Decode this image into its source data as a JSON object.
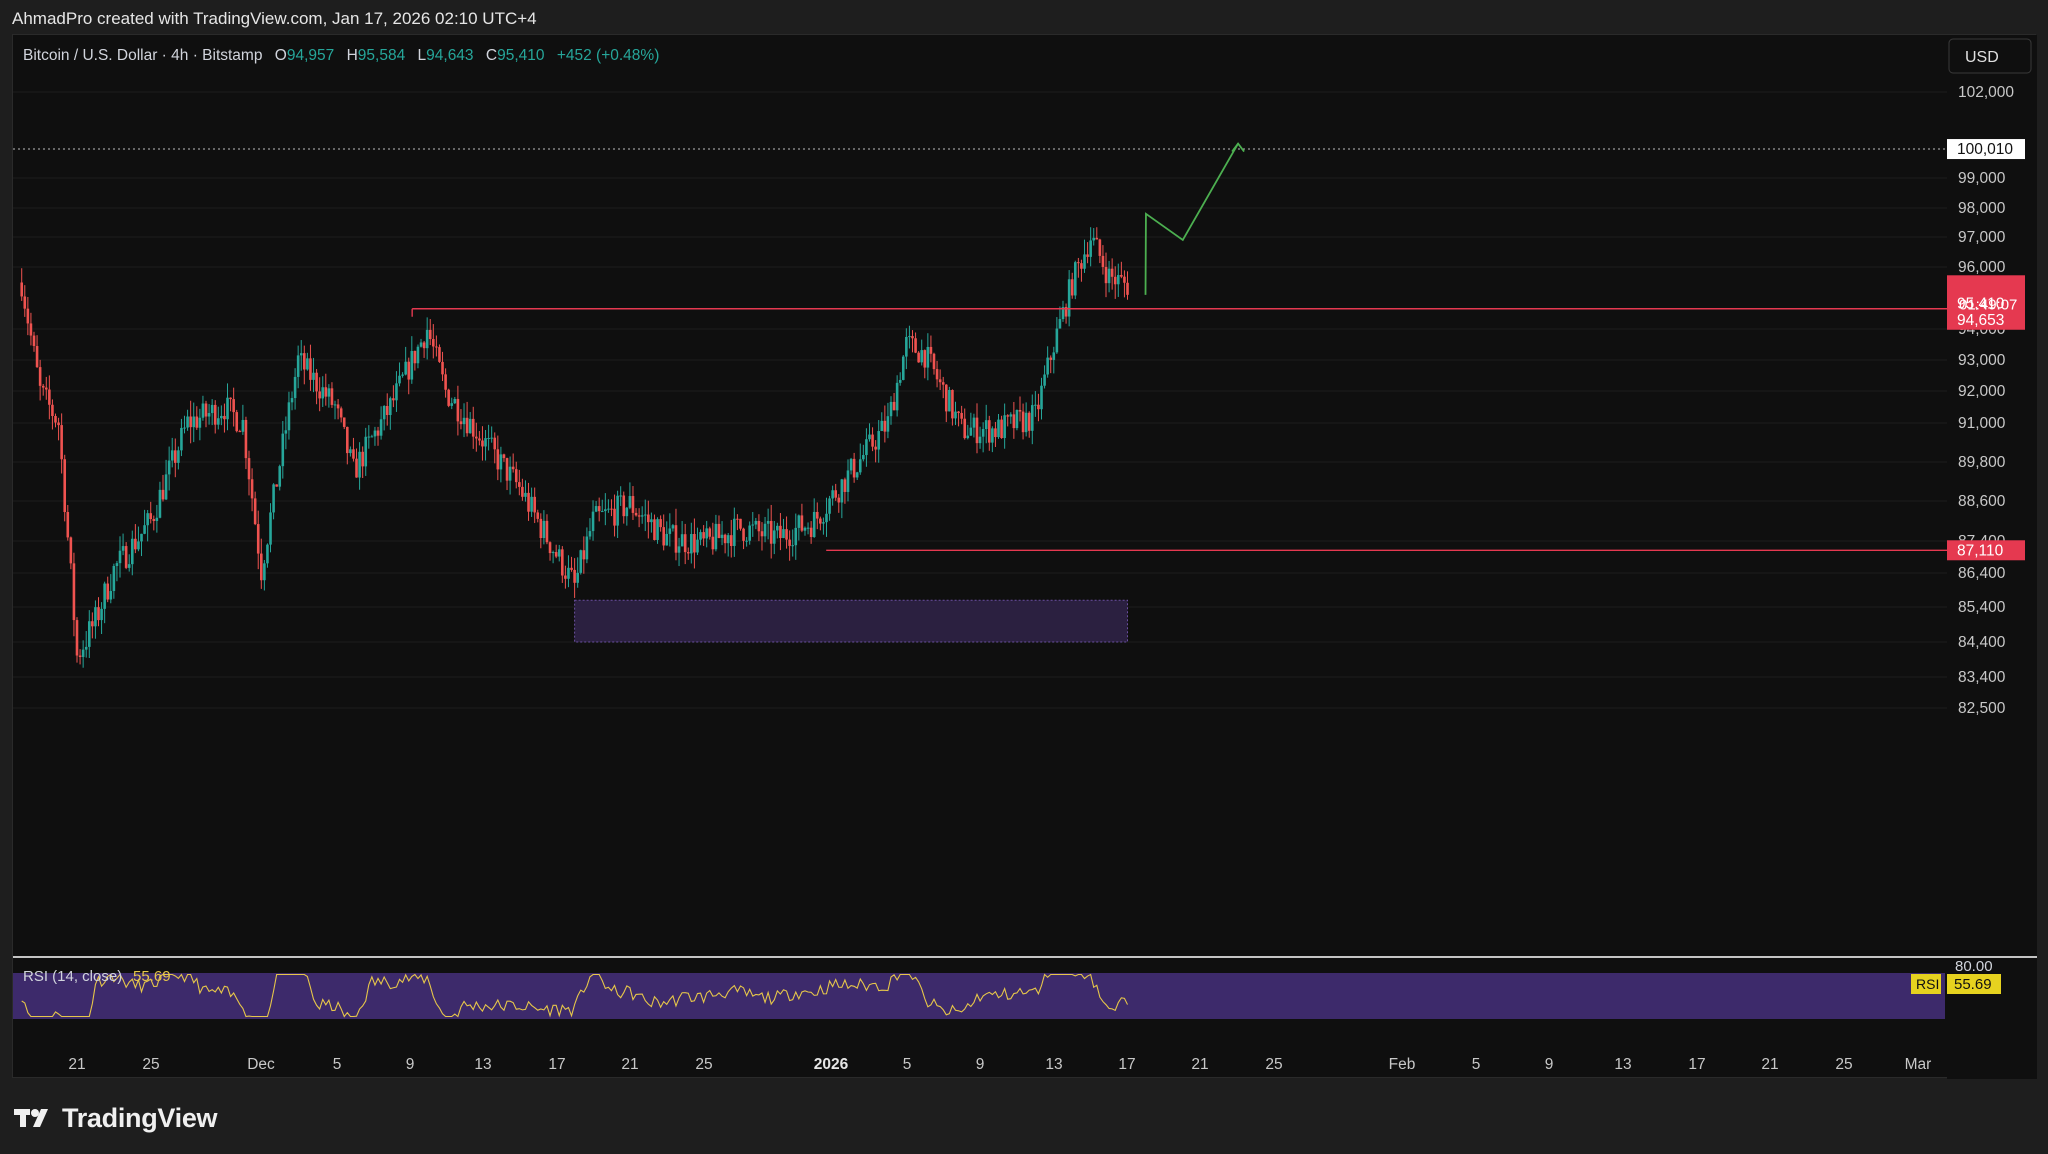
{
  "header": {
    "credit": "AhmadPro created with TradingView.com, Jan 17, 2026 02:10 UTC+4"
  },
  "symbol": {
    "name": "Bitcoin / U.S. Dollar · 4h · Bitstamp",
    "open_label": "O",
    "open": "94,957",
    "high_label": "H",
    "high": "95,584",
    "low_label": "L",
    "low": "94,643",
    "close_label": "C",
    "close": "95,410",
    "change": "+452 (+0.48%)"
  },
  "currency_button": "USD",
  "price_axis": {
    "ticks": [
      {
        "label": "102,000",
        "value": 102000
      },
      {
        "label": "99,000",
        "value": 99000
      },
      {
        "label": "98,000",
        "value": 98000
      },
      {
        "label": "97,000",
        "value": 97000
      },
      {
        "label": "96,000",
        "value": 96000
      },
      {
        "label": "94,000",
        "value": 94000
      },
      {
        "label": "93,000",
        "value": 93000
      },
      {
        "label": "92,000",
        "value": 92000
      },
      {
        "label": "91,000",
        "value": 91000
      },
      {
        "label": "89,800",
        "value": 89800
      },
      {
        "label": "88,600",
        "value": 88600
      },
      {
        "label": "87,400",
        "value": 87400
      },
      {
        "label": "86,400",
        "value": 86400
      },
      {
        "label": "85,400",
        "value": 85400
      },
      {
        "label": "84,400",
        "value": 84400
      },
      {
        "label": "83,400",
        "value": 83400
      },
      {
        "label": "82,500",
        "value": 82500
      }
    ],
    "badges": {
      "target": {
        "label": "100,010",
        "value": 100010
      },
      "last_price": {
        "label": "95,410",
        "value": 95410
      },
      "countdown": "01:49:07",
      "resistance": {
        "label": "94,653",
        "value": 94653
      },
      "support": {
        "label": "87,110",
        "value": 87110
      }
    }
  },
  "time_axis": {
    "ticks": [
      {
        "label": "21",
        "bold": false
      },
      {
        "label": "25",
        "bold": false
      },
      {
        "label": "Dec",
        "bold": false
      },
      {
        "label": "5",
        "bold": false
      },
      {
        "label": "9",
        "bold": false
      },
      {
        "label": "13",
        "bold": false
      },
      {
        "label": "17",
        "bold": false
      },
      {
        "label": "21",
        "bold": false
      },
      {
        "label": "25",
        "bold": false
      },
      {
        "label": "2026",
        "bold": true
      },
      {
        "label": "5",
        "bold": false
      },
      {
        "label": "9",
        "bold": false
      },
      {
        "label": "13",
        "bold": false
      },
      {
        "label": "17",
        "bold": false
      },
      {
        "label": "21",
        "bold": false
      },
      {
        "label": "25",
        "bold": false
      },
      {
        "label": "Feb",
        "bold": false
      },
      {
        "label": "5",
        "bold": false
      },
      {
        "label": "9",
        "bold": false
      },
      {
        "label": "13",
        "bold": false
      },
      {
        "label": "17",
        "bold": false
      },
      {
        "label": "21",
        "bold": false
      },
      {
        "label": "25",
        "bold": false
      },
      {
        "label": "Mar",
        "bold": false
      }
    ]
  },
  "rsi": {
    "label": "RSI (14, close)",
    "value": "55.69",
    "axis_label": "80.00",
    "badge_name": "RSI",
    "badge_value": "55.69"
  },
  "colors": {
    "up": "#26a69a",
    "down": "#ef5350",
    "level_line": "#e53950",
    "projection": "#4caf50",
    "zone_fill": "#2b2040",
    "rsi_fill": "#3d2a6b",
    "rsi_line": "#e6c64a",
    "badge_red": "#e53950",
    "price_teal": "#26a69a"
  },
  "chart_data": {
    "type": "candlestick",
    "symbol": "Bitcoin / U.S. Dollar",
    "interval": "4h",
    "ylim": [
      82000,
      103500
    ],
    "close_path": [
      [
        "Nov 18",
        95500
      ],
      [
        "Nov 19",
        92000
      ],
      [
        "Nov 20",
        91000
      ],
      [
        "Nov 21",
        84000
      ],
      [
        "Nov 22",
        85000
      ],
      [
        "Nov 23",
        86500
      ],
      [
        "Nov 25",
        88000
      ],
      [
        "Nov 27",
        91000
      ],
      [
        "Nov 29",
        91500
      ],
      [
        "Nov 30",
        91000
      ],
      [
        "Dec 1",
        86500
      ],
      [
        "Dec 3",
        93000
      ],
      [
        "Dec 5",
        91500
      ],
      [
        "Dec 6",
        89500
      ],
      [
        "Dec 8",
        91500
      ],
      [
        "Dec 10",
        94000
      ],
      [
        "Dec 11",
        92000
      ],
      [
        "Dec 13",
        90500
      ],
      [
        "Dec 15",
        89000
      ],
      [
        "Dec 17",
        87000
      ],
      [
        "Dec 18",
        86000
      ],
      [
        "Dec 19",
        88000
      ],
      [
        "Dec 21",
        88500
      ],
      [
        "Dec 23",
        87500
      ],
      [
        "Dec 25",
        87300
      ],
      [
        "Dec 27",
        87800
      ],
      [
        "Dec 29",
        87500
      ],
      [
        "Dec 31",
        88000
      ],
      [
        "Jan 2",
        89500
      ],
      [
        "Jan 4",
        91000
      ],
      [
        "Jan 5",
        93500
      ],
      [
        "Jan 6",
        93200
      ],
      [
        "Jan 7",
        92000
      ],
      [
        "Jan 8",
        90800
      ],
      [
        "Jan 10",
        90800
      ],
      [
        "Jan 12",
        91200
      ],
      [
        "Jan 13",
        93500
      ],
      [
        "Jan 14",
        95500
      ],
      [
        "Jan 15",
        97000
      ],
      [
        "Jan 16",
        95700
      ],
      [
        "Jan 17",
        95410
      ]
    ],
    "levels": [
      94653,
      87110,
      100010
    ],
    "zone": {
      "from": "Dec 18",
      "to": "Jan 17",
      "low": 84400,
      "high": 85600
    },
    "projection": [
      [
        "Jan 17",
        95100
      ],
      [
        "Jan 18",
        97800
      ],
      [
        "Jan 20",
        96900
      ],
      [
        "Jan 23",
        100200
      ]
    ],
    "rsi_last": 55.69
  }
}
